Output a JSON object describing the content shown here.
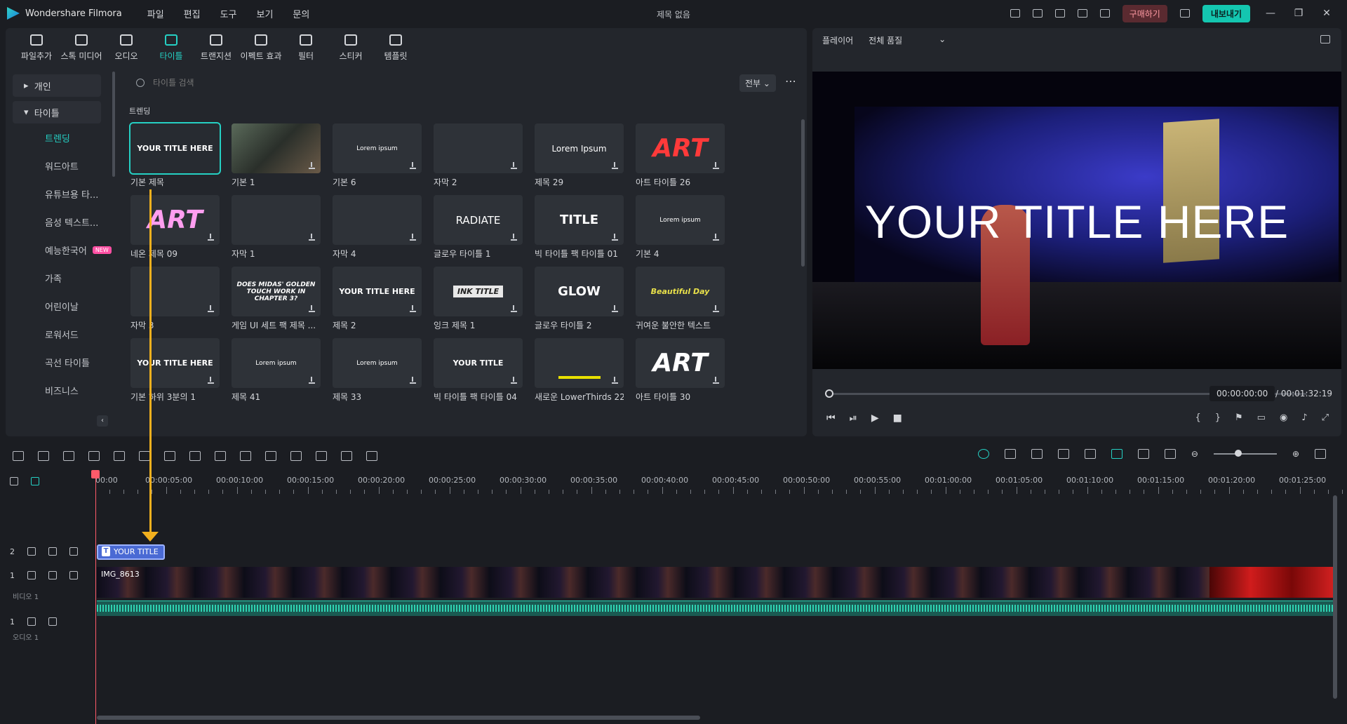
{
  "app": {
    "name": "Wondershare Filmora",
    "window_title": "제목 없음",
    "menu": [
      "파일",
      "편집",
      "도구",
      "보기",
      "문의"
    ]
  },
  "header": {
    "buy_label": "구매하기",
    "export_label": "내보내기"
  },
  "toolbar": {
    "items": [
      {
        "label": "파일추가",
        "icon": "media-icon"
      },
      {
        "label": "스톡 미디어",
        "icon": "stock-icon"
      },
      {
        "label": "오디오",
        "icon": "music-icon"
      },
      {
        "label": "타이틀",
        "icon": "title-icon",
        "active": true
      },
      {
        "label": "트랜지션",
        "icon": "transition-icon"
      },
      {
        "label": "이펙트 효과",
        "icon": "effects-icon"
      },
      {
        "label": "필터",
        "icon": "filter-icon"
      },
      {
        "label": "스티커",
        "icon": "sticker-icon"
      },
      {
        "label": "템플릿",
        "icon": "template-icon"
      }
    ]
  },
  "sidebar": {
    "group_personal": "개인",
    "group_titles": "타이틀",
    "items": [
      "트렌딩",
      "워드아트",
      "유튜브용 타...",
      "음성 텍스트...",
      "예능한국어",
      "가족",
      "어린이날",
      "로워서드",
      "곡선 타이틀",
      "비즈니스"
    ],
    "new_badge": "NEW"
  },
  "search": {
    "placeholder": "타이틀 검색",
    "filter": "전부"
  },
  "section": "트렌딩",
  "cards": [
    {
      "label": "기본 제목",
      "thumb": "YOUR TITLE HERE"
    },
    {
      "label": "기본 1",
      "thumb": ""
    },
    {
      "label": "기본 6",
      "thumb": "Lorem ipsum"
    },
    {
      "label": "자막 2",
      "thumb": ""
    },
    {
      "label": "제목 29",
      "thumb": "Lorem Ipsum"
    },
    {
      "label": "아트 타이틀 26",
      "thumb": "ART"
    },
    {
      "label": "네온 제목 09",
      "thumb": "ART"
    },
    {
      "label": "자막 1",
      "thumb": ""
    },
    {
      "label": "자막 4",
      "thumb": ""
    },
    {
      "label": "글로우 타이틀 1",
      "thumb": "RADIATE"
    },
    {
      "label": "빅 타이틀 팩 타이틀 01",
      "thumb": "TITLE"
    },
    {
      "label": "기본 4",
      "thumb": "Lorem ipsum"
    },
    {
      "label": "자막 3",
      "thumb": ""
    },
    {
      "label": "게임 UI 세트 팩 제목 ...",
      "thumb": "DOES MIDAS' GOLDEN TOUCH WORK IN CHAPTER 3?"
    },
    {
      "label": "제목 2",
      "thumb": "YOUR TITLE HERE"
    },
    {
      "label": "잉크 제목 1",
      "thumb": "INK TITLE"
    },
    {
      "label": "글로우 타이틀 2",
      "thumb": "GLOW"
    },
    {
      "label": "귀여운 불안한 텍스트",
      "thumb": "Beautiful Day"
    },
    {
      "label": "기본 하위 3분의 1",
      "thumb": "YOUR TITLE HERE"
    },
    {
      "label": "제목 41",
      "thumb": "Lorem ipsum"
    },
    {
      "label": "제목 33",
      "thumb": "Lorem ipsum"
    },
    {
      "label": "빅 타이틀 팩 타이틀 04",
      "thumb": "YOUR TITLE"
    },
    {
      "label": "새로운 LowerThirds 22",
      "thumb": ""
    },
    {
      "label": "아트 타이틀 30",
      "thumb": "ART"
    }
  ],
  "player": {
    "label": "플레이어",
    "quality": "전체 품질",
    "overlay_title": "YOUR TITLE HERE",
    "current": "00:00:00:00",
    "total": "/  00:01:32:19"
  },
  "timeline": {
    "ticks": [
      "00:00",
      "00:00:05:00",
      "00:00:10:00",
      "00:00:15:00",
      "00:00:20:00",
      "00:00:25:00",
      "00:00:30:00",
      "00:00:35:00",
      "00:00:40:00",
      "00:00:45:00",
      "00:00:50:00",
      "00:00:55:00",
      "00:01:00:00",
      "00:01:05:00",
      "00:01:10:00",
      "00:01:15:00",
      "00:01:20:00",
      "00:01:25:00"
    ],
    "title_clip": "YOUR TITLE",
    "video_clip": "IMG_8613",
    "track_video": "비디오 1",
    "track_audio": "오디오 1",
    "track_nums": [
      "2",
      "1",
      "1"
    ]
  }
}
